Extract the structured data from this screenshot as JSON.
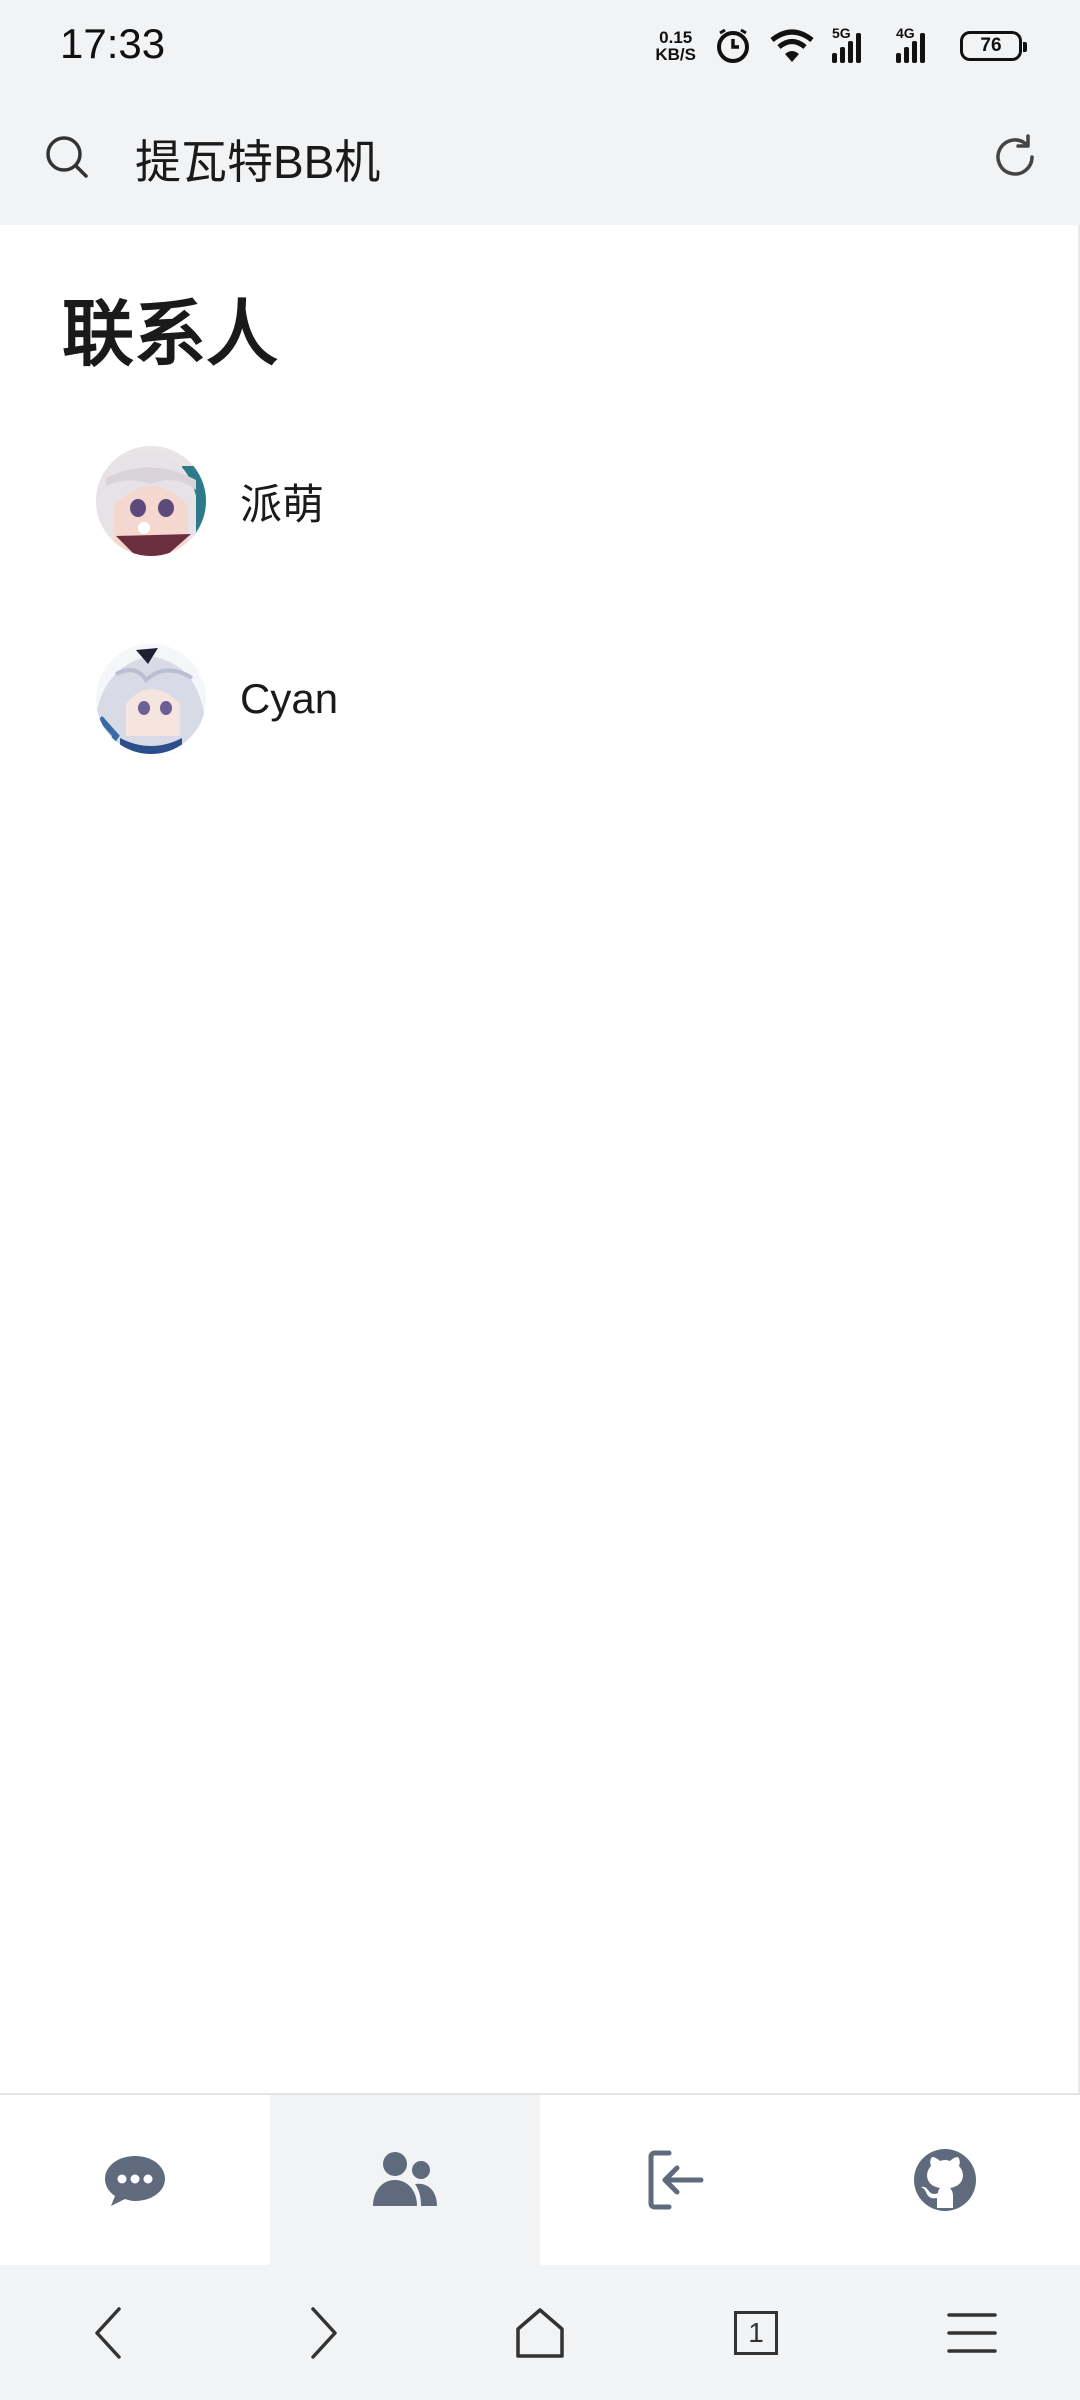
{
  "status_bar": {
    "time": "17:33",
    "net_speed_value": "0.15",
    "net_speed_unit": "KB/S",
    "sim1_label": "5G",
    "sim2_label": "4G",
    "battery": "76",
    "icons": [
      "alarm-icon",
      "wifi-icon",
      "signal-icon",
      "battery-icon"
    ]
  },
  "address_bar": {
    "text": "提瓦特BB机",
    "icons": [
      "search-icon",
      "reload-icon"
    ]
  },
  "page": {
    "title": "联系人",
    "contacts": [
      {
        "name": "派萌",
        "avatar": "avatar-paimon"
      },
      {
        "name": "Cyan",
        "avatar": "avatar-cyan"
      }
    ]
  },
  "tab_bar": {
    "tabs": [
      {
        "icon": "chat-icon",
        "active": false
      },
      {
        "icon": "contacts-icon",
        "active": true
      },
      {
        "icon": "logout-icon",
        "active": false
      },
      {
        "icon": "github-icon",
        "active": false
      }
    ],
    "icon_color": "#5f6b7c"
  },
  "browser_nav": {
    "tabs_count": "1",
    "icons": [
      "back-icon",
      "forward-icon",
      "home-icon",
      "tabs-icon",
      "menu-icon"
    ]
  },
  "colors": {
    "chrome_bg": "#f2f3f5",
    "page_bg": "#ffffff",
    "text": "#1a1a1a"
  }
}
